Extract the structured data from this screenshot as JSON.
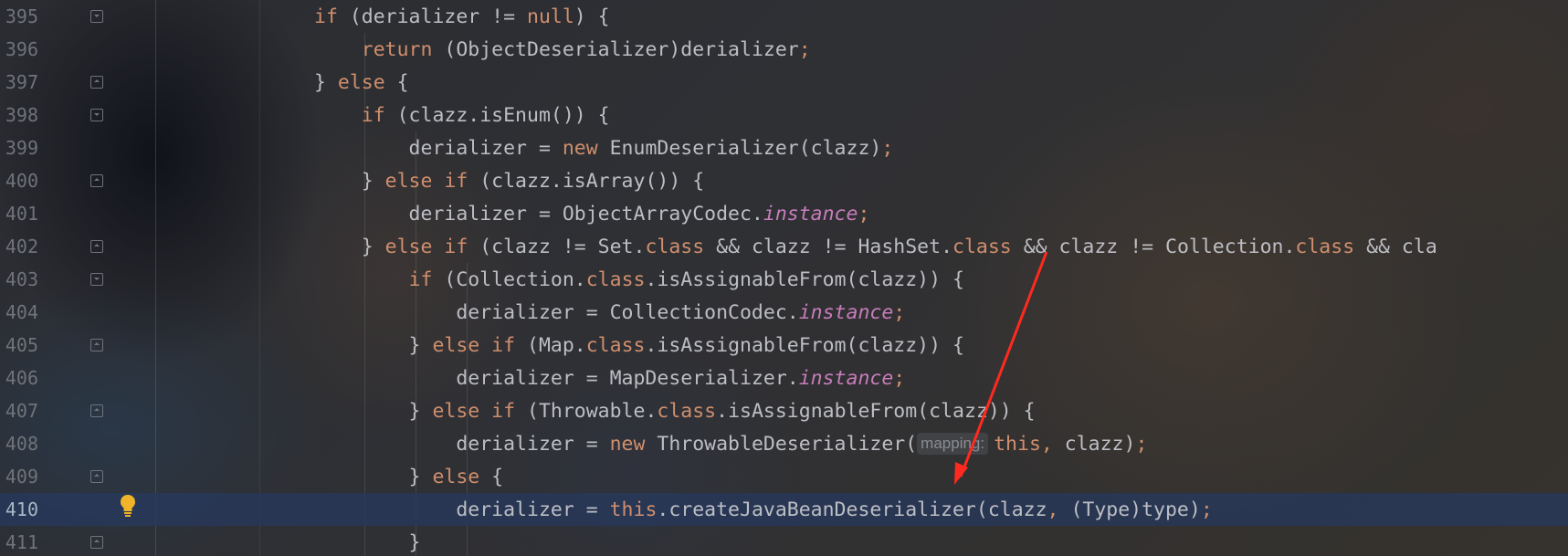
{
  "editor": {
    "current_line": 410,
    "lines": [
      {
        "no": "395",
        "tokens": [
          {
            "t": "if",
            "c": "kw"
          },
          {
            "t": " (derializer != "
          },
          {
            "t": "null",
            "c": "kw"
          },
          {
            "t": ") {"
          }
        ]
      },
      {
        "no": "396",
        "tokens": [
          {
            "t": "    "
          },
          {
            "t": "return",
            "c": "kw"
          },
          {
            "t": " (ObjectDeserializer)derializer"
          },
          {
            "t": ";",
            "c": "kw"
          }
        ]
      },
      {
        "no": "397",
        "tokens": [
          {
            "t": "} "
          },
          {
            "t": "else",
            "c": "kw"
          },
          {
            "t": " {"
          }
        ]
      },
      {
        "no": "398",
        "tokens": [
          {
            "t": "    "
          },
          {
            "t": "if",
            "c": "kw"
          },
          {
            "t": " (clazz.isEnum()) {"
          }
        ]
      },
      {
        "no": "399",
        "tokens": [
          {
            "t": "        derializer = "
          },
          {
            "t": "new",
            "c": "kw"
          },
          {
            "t": " EnumDeserializer(clazz)"
          },
          {
            "t": ";",
            "c": "kw"
          }
        ]
      },
      {
        "no": "400",
        "tokens": [
          {
            "t": "    } "
          },
          {
            "t": "else if",
            "c": "kw"
          },
          {
            "t": " (clazz.isArray()) {"
          }
        ]
      },
      {
        "no": "401",
        "tokens": [
          {
            "t": "        derializer = ObjectArrayCodec."
          },
          {
            "t": "instance",
            "c": "fld"
          },
          {
            "t": ";",
            "c": "kw"
          }
        ]
      },
      {
        "no": "402",
        "tokens": [
          {
            "t": "    } "
          },
          {
            "t": "else if",
            "c": "kw"
          },
          {
            "t": " (clazz != Set."
          },
          {
            "t": "class",
            "c": "kw"
          },
          {
            "t": " && clazz != HashSet."
          },
          {
            "t": "class",
            "c": "kw"
          },
          {
            "t": " && clazz != Collection."
          },
          {
            "t": "class",
            "c": "kw"
          },
          {
            "t": " && cla"
          }
        ]
      },
      {
        "no": "403",
        "tokens": [
          {
            "t": "        "
          },
          {
            "t": "if",
            "c": "kw"
          },
          {
            "t": " (Collection."
          },
          {
            "t": "class",
            "c": "kw"
          },
          {
            "t": ".isAssignableFrom(clazz)) {"
          }
        ]
      },
      {
        "no": "404",
        "tokens": [
          {
            "t": "            derializer = CollectionCodec."
          },
          {
            "t": "instance",
            "c": "fld"
          },
          {
            "t": ";",
            "c": "kw"
          }
        ]
      },
      {
        "no": "405",
        "tokens": [
          {
            "t": "        } "
          },
          {
            "t": "else if",
            "c": "kw"
          },
          {
            "t": " (Map."
          },
          {
            "t": "class",
            "c": "kw"
          },
          {
            "t": ".isAssignableFrom(clazz)) {"
          }
        ]
      },
      {
        "no": "406",
        "tokens": [
          {
            "t": "            derializer = MapDeserializer."
          },
          {
            "t": "instance",
            "c": "fld"
          },
          {
            "t": ";",
            "c": "kw"
          }
        ]
      },
      {
        "no": "407",
        "tokens": [
          {
            "t": "        } "
          },
          {
            "t": "else if",
            "c": "kw"
          },
          {
            "t": " (Throwable."
          },
          {
            "t": "class",
            "c": "kw"
          },
          {
            "t": ".isAssignableFrom(clazz)) {"
          }
        ]
      },
      {
        "no": "408",
        "tokens": [
          {
            "t": "            derializer = "
          },
          {
            "t": "new",
            "c": "kw"
          },
          {
            "t": " ThrowableDeserializer("
          },
          {
            "t": "mapping:",
            "c": "hint"
          },
          {
            "t": "this",
            "c": "kw"
          },
          {
            "t": ", ",
            "c": "kw"
          },
          {
            "t": "clazz)"
          },
          {
            "t": ";",
            "c": "kw"
          }
        ]
      },
      {
        "no": "409",
        "tokens": [
          {
            "t": "        } "
          },
          {
            "t": "else",
            "c": "kw"
          },
          {
            "t": " {"
          }
        ]
      },
      {
        "no": "410",
        "tokens": [
          {
            "t": "            derializer = "
          },
          {
            "t": "this",
            "c": "kw"
          },
          {
            "t": ".createJavaBeanDeserializer(clazz"
          },
          {
            "t": ", ",
            "c": "kw"
          },
          {
            "t": "(Type)type)"
          },
          {
            "t": ";",
            "c": "kw"
          }
        ]
      },
      {
        "no": "411",
        "tokens": [
          {
            "t": "        }"
          }
        ]
      }
    ],
    "folds": [
      {
        "no": "395",
        "kind": "open"
      },
      {
        "no": "397",
        "kind": "close"
      },
      {
        "no": "398",
        "kind": "open"
      },
      {
        "no": "400",
        "kind": "close"
      },
      {
        "no": "402",
        "kind": "close"
      },
      {
        "no": "403",
        "kind": "open"
      },
      {
        "no": "405",
        "kind": "close"
      },
      {
        "no": "407",
        "kind": "close"
      },
      {
        "no": "409",
        "kind": "close"
      },
      {
        "no": "411",
        "kind": "close"
      }
    ],
    "icons": {
      "bulb": "lightbulb-icon",
      "arrow": "red-arrow-annotation"
    },
    "colors": {
      "keyword": "#cf8e6d",
      "field": "#c77dbb",
      "text": "#bcbec4",
      "current_line": "#26385c",
      "arrow": "#ff2a1f",
      "bulb": "#f0b429"
    }
  }
}
